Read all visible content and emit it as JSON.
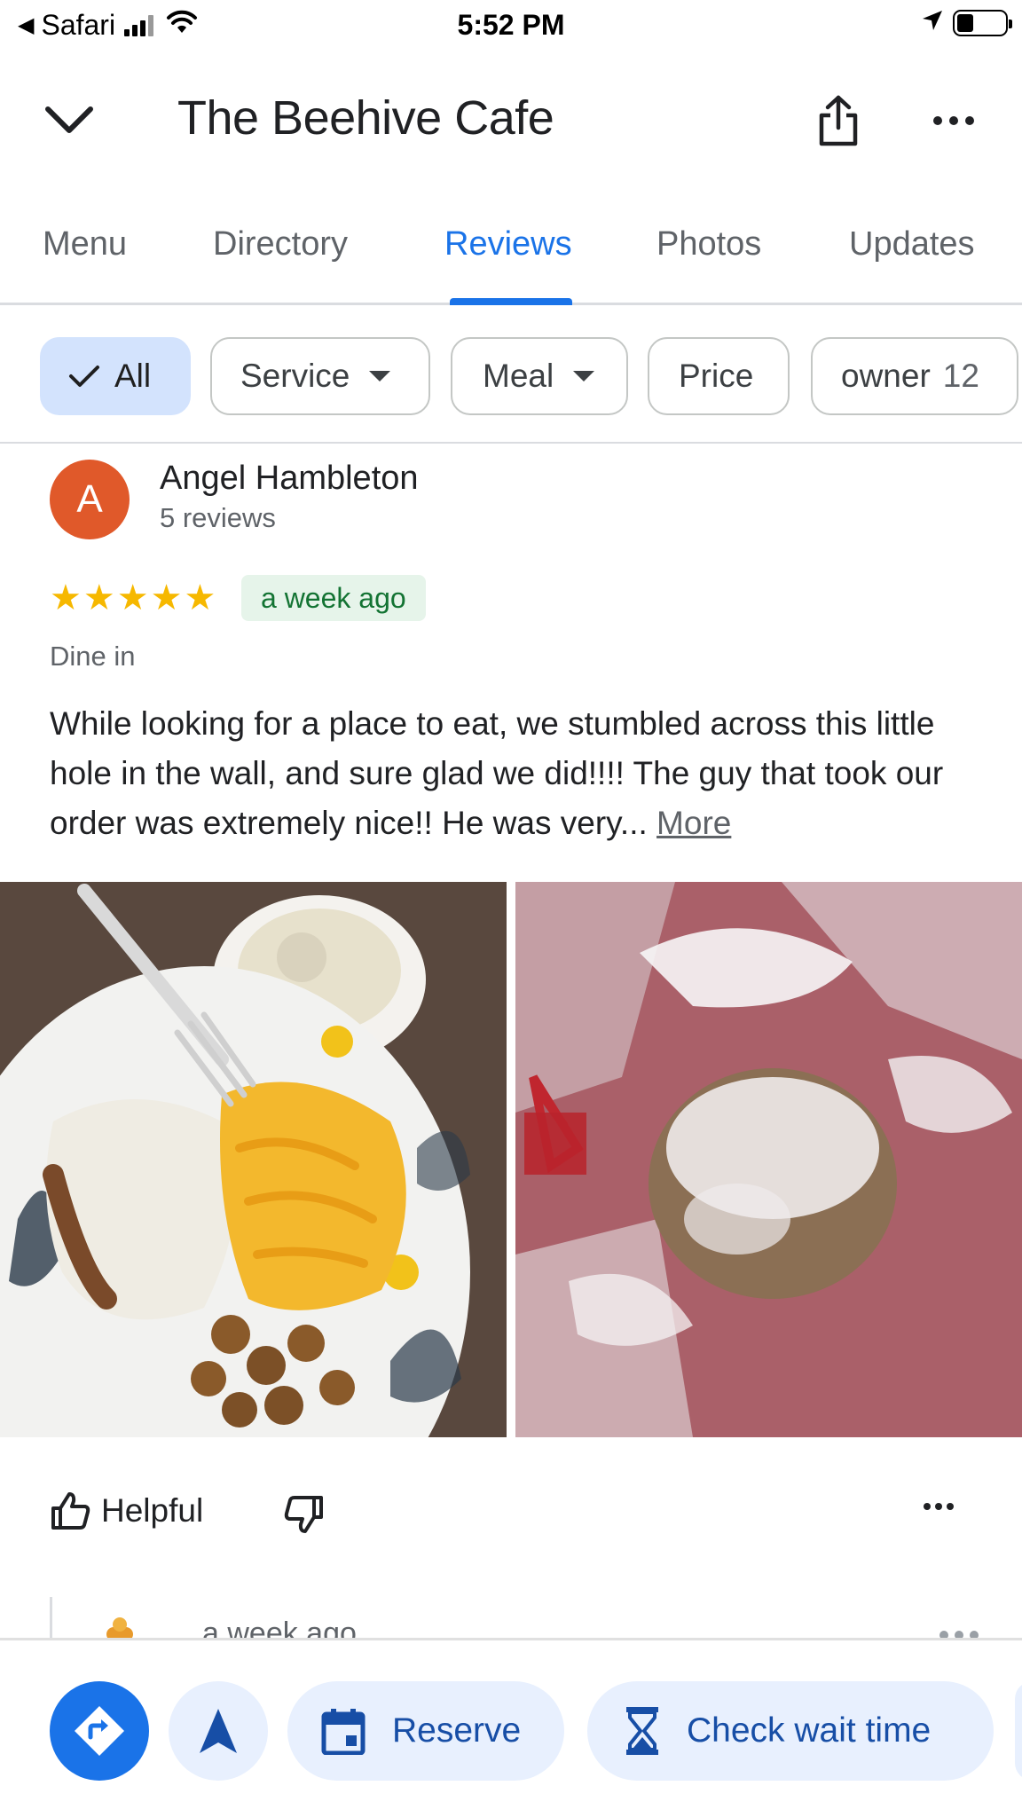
{
  "status_bar": {
    "back_app": "Safari",
    "time": "5:52 PM"
  },
  "header": {
    "title": "The Beehive Cafe"
  },
  "tabs": [
    {
      "label": "Menu",
      "active": false
    },
    {
      "label": "Directory",
      "active": false
    },
    {
      "label": "Reviews",
      "active": true
    },
    {
      "label": "Photos",
      "active": false
    },
    {
      "label": "Updates",
      "active": false
    }
  ],
  "filters": {
    "all": "All",
    "service": "Service",
    "meal": "Meal",
    "price": "Price",
    "owner": "owner",
    "owner_count": "12"
  },
  "review": {
    "avatar_letter": "A",
    "avatar_color": "#e0592a",
    "name": "Angel Hambleton",
    "review_count": "5 reviews",
    "rating": 5,
    "rating_max": 5,
    "time_ago": "a week ago",
    "tag": "Dine in",
    "text": "While looking for a place to eat, we stumbled across this little hole in the wall, and sure glad we did!!!! The guy that took our order was extremely nice!! He was very...",
    "more_link": "More",
    "photos": [
      "photo-plate-of-food",
      "photo-powdered-sugar-pastry"
    ]
  },
  "actions": {
    "helpful": "Helpful"
  },
  "owner_reply": {
    "time_ago": "a week ago"
  },
  "bottom_bar": {
    "reserve": "Reserve",
    "check_wait": "Check wait time"
  },
  "colors": {
    "accent": "#1a73e8",
    "star": "#f6b800",
    "badge_bg": "#e6f4ea",
    "badge_text": "#137333"
  }
}
